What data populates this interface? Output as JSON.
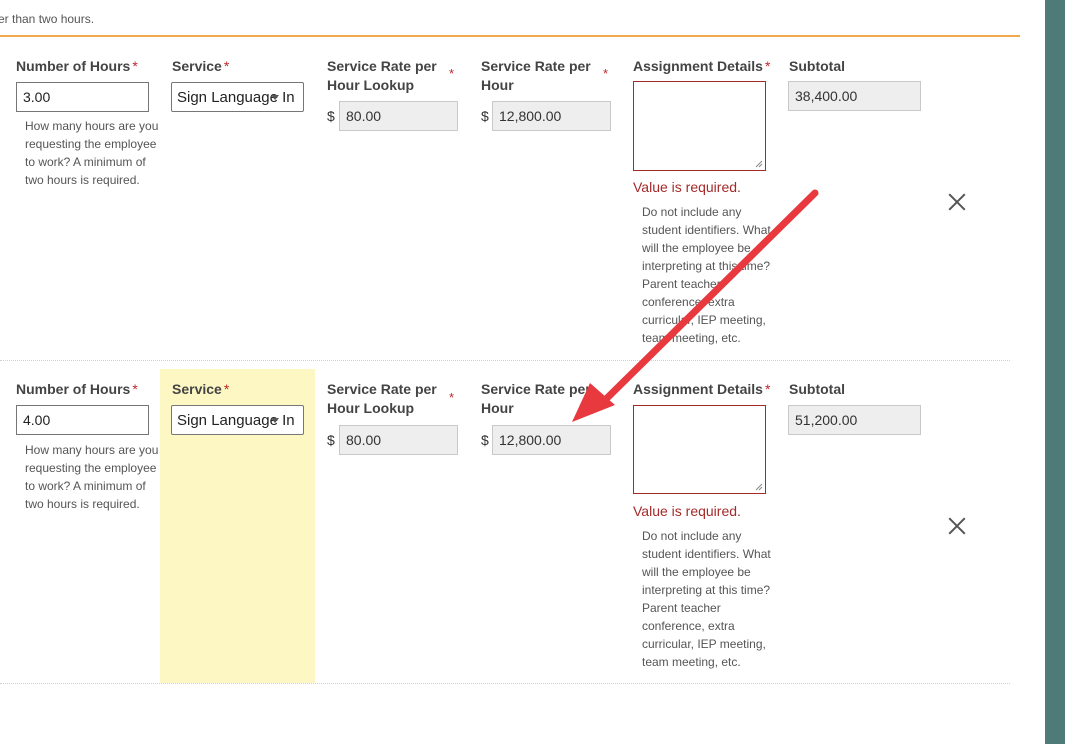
{
  "top_note": "er than two hours.",
  "labels": {
    "hours": "Number of Hours",
    "service": "Service",
    "rate_lookup": "Service Rate per Hour Lookup",
    "rate": "Service Rate per Hour",
    "details": "Assignment Details",
    "subtotal": "Subtotal",
    "required_marker": "*",
    "currency": "$"
  },
  "hours_help": "How many hours are you requesting the employee to work? A minimum of two hours is required.",
  "details_help": "Do not include any student identifiers. What will the employee be interpreting at this time? Parent teacher conference, extra curricular, IEP meeting, team meeting, etc.",
  "error_message": "Value is required.",
  "rows": [
    {
      "hours": "3.00",
      "service": "Sign Language Interpreter",
      "rate_lookup": "80.00",
      "rate": "12,800.00",
      "subtotal": "38,400.00"
    },
    {
      "hours": "4.00",
      "service": "Sign Language Interpreter",
      "rate_lookup": "80.00",
      "rate": "12,800.00",
      "subtotal": "51,200.00"
    }
  ],
  "colors": {
    "accent_line": "#f0a94b",
    "error": "#a52a2a",
    "highlight": "#fdf7c3",
    "side_rail": "#507a78",
    "annotation_arrow": "#e8393f"
  },
  "icons": {
    "remove": "close-icon",
    "dropdown": "chevron-down-icon"
  }
}
